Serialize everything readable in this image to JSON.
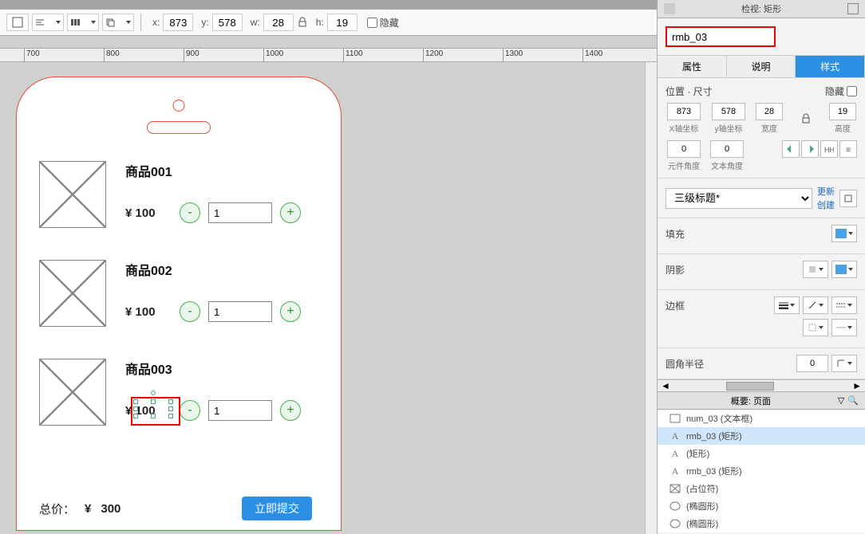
{
  "toolbar": {
    "x_label": "x:",
    "x": "873",
    "y_label": "y:",
    "y": "578",
    "w_label": "w:",
    "w": "28",
    "h_label": "h:",
    "h": "19",
    "hide": "隐藏"
  },
  "ruler_ticks": [
    "700",
    "800",
    "900",
    "1000",
    "1100",
    "1200",
    "1300",
    "1400"
  ],
  "phone": {
    "items": [
      {
        "name": "商品001",
        "price": "¥ 100",
        "qty": "1"
      },
      {
        "name": "商品002",
        "price": "¥ 100",
        "qty": "1"
      },
      {
        "name": "商品003",
        "price": "¥ 100",
        "qty": "1"
      }
    ],
    "minus": "-",
    "plus": "+",
    "total_label": "总价：",
    "total_cur": "¥",
    "total_val": "300",
    "submit": "立即提交"
  },
  "inspector": {
    "title": "检视: 矩形",
    "element_name": "rmb_03",
    "tabs": [
      "属性",
      "说明",
      "样式"
    ],
    "pos_title": "位置 · 尺寸",
    "hide_label": "隐藏",
    "x": "873",
    "y": "578",
    "w": "28",
    "h": "19",
    "x_lbl": "X轴坐标",
    "y_lbl": "y轴坐标",
    "w_lbl": "宽度",
    "h_lbl": "高度",
    "elem_ang": "0",
    "text_ang": "0",
    "elem_ang_lbl": "元件角度",
    "text_ang_lbl": "文本角度",
    "style_select": "三级标题*",
    "link_update": "更新",
    "link_create": "创建",
    "fill_label": "填充",
    "shadow_label": "阴影",
    "border_label": "边框",
    "radius_label": "圆角半径",
    "radius_val": "0"
  },
  "outline": {
    "title": "概要: 页面",
    "rows": [
      {
        "icon": "rect",
        "label": "num_03 (文本框)"
      },
      {
        "icon": "A",
        "label": "rmb_03 (矩形)",
        "selected": true
      },
      {
        "icon": "A",
        "label": "(矩形)"
      },
      {
        "icon": "A",
        "label": "rmb_03 (矩形)"
      },
      {
        "icon": "ph",
        "label": "(占位符)"
      },
      {
        "icon": "circ",
        "label": "(椭圆形)"
      },
      {
        "icon": "circ",
        "label": "(椭圆形)"
      }
    ]
  }
}
